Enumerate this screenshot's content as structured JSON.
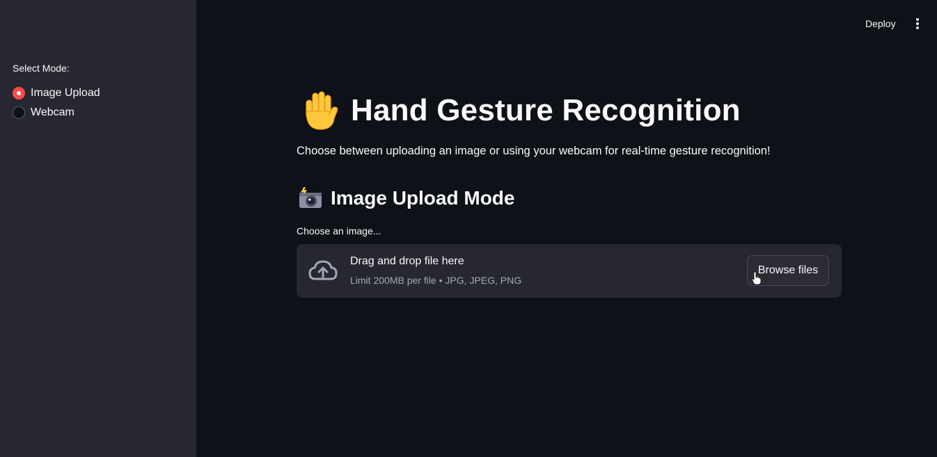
{
  "sidebar": {
    "label": "Select Mode:",
    "options": [
      {
        "label": "Image Upload",
        "selected": true
      },
      {
        "label": "Webcam",
        "selected": false
      }
    ]
  },
  "topbar": {
    "deploy_label": "Deploy",
    "menu_icon": "vertical-ellipsis-icon"
  },
  "main": {
    "title_icon": "raised-hand-icon",
    "title": "Hand Gesture Recognition",
    "subtitle": "Choose between uploading an image or using your webcam for real-time gesture recognition!",
    "section_icon": "camera-flash-icon",
    "section_title": "Image Upload Mode",
    "uploader": {
      "label": "Choose an image...",
      "icon": "cloud-upload-icon",
      "drop_text": "Drag and drop file here",
      "limit_text": "Limit 200MB per file • JPG, JPEG, PNG",
      "button_label": "Browse files"
    }
  },
  "colors": {
    "background": "#0e1117",
    "sidebar": "#262730",
    "accent": "#ff4b4b",
    "text": "#fafafa",
    "muted_text": "#a3a8b8"
  }
}
